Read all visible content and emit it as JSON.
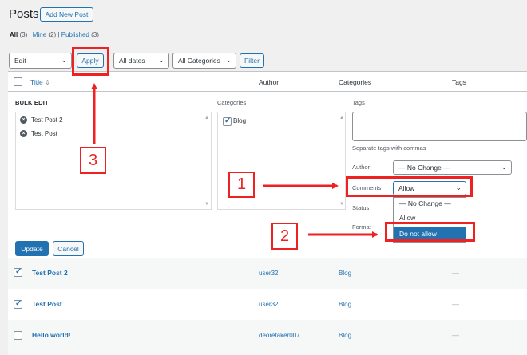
{
  "header": {
    "title": "Posts",
    "add_new_label": "Add New Post"
  },
  "views": [
    {
      "label": "All",
      "count": "(3)"
    },
    {
      "label": "Mine",
      "count": "(2)"
    },
    {
      "label": "Published",
      "count": "(3)"
    }
  ],
  "views_separator": "|",
  "toolbar": {
    "bulk_action": "Edit",
    "apply_label": "Apply",
    "date_filter": "All dates",
    "category_filter": "All Categories",
    "filter_label": "Filter"
  },
  "columns": {
    "title": "Title",
    "title_sort_icon": "sort-icon",
    "author": "Author",
    "categories": "Categories",
    "tags": "Tags"
  },
  "bulk_edit": {
    "heading": "BULK EDIT",
    "posts": [
      "Test Post 2",
      "Test Post"
    ],
    "categories_label": "Categories",
    "category_options": [
      {
        "label": "Blog",
        "checked": true
      }
    ],
    "tags_label": "Tags",
    "tags_hint": "Separate tags with commas",
    "author_label": "Author",
    "author_value": "— No Change —",
    "comments_label": "Comments",
    "comments_value": "Allow",
    "comments_options": [
      "— No Change —",
      "Allow",
      "Do not allow"
    ],
    "comments_highlighted": "Do not allow",
    "status_label": "Status",
    "format_label": "Format",
    "update_label": "Update",
    "cancel_label": "Cancel"
  },
  "rows": [
    {
      "title": "Test Post 2",
      "author": "user32",
      "category": "Blog",
      "tags": "—",
      "checked": true
    },
    {
      "title": "Test Post",
      "author": "user32",
      "category": "Blog",
      "tags": "—",
      "checked": true
    },
    {
      "title": "Hello world!",
      "author": "deoretaker007",
      "category": "Blog",
      "tags": "—",
      "checked": false
    }
  ],
  "annotations": {
    "step1": "1",
    "step2": "2",
    "step3": "3"
  },
  "colors": {
    "accent": "#2271b1",
    "annotation": "#ee2222",
    "background": "#f0f0f1"
  }
}
